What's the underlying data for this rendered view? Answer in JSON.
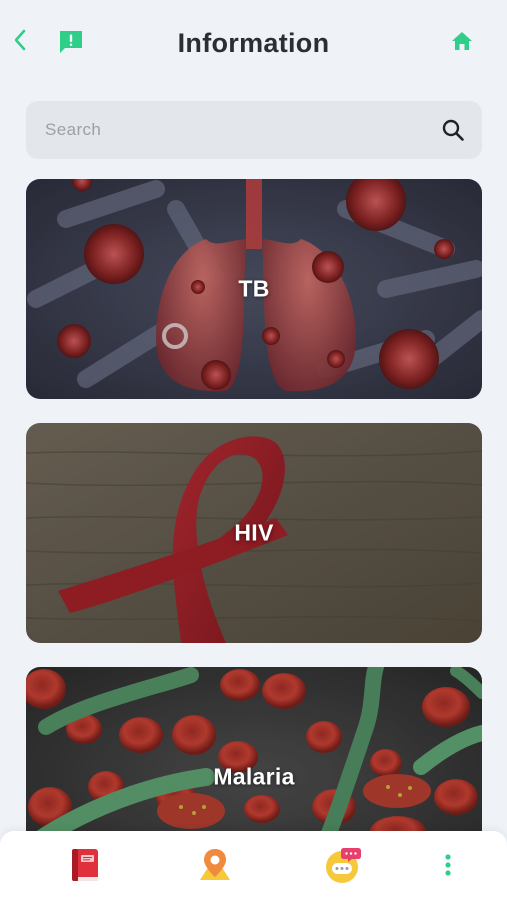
{
  "header": {
    "title": "Information",
    "back_icon": "chevron-left-icon",
    "feedback_icon": "feedback-icon",
    "home_icon": "home-icon",
    "accent_color": "#2fcf8a"
  },
  "search": {
    "placeholder": "Search",
    "value": "",
    "icon": "search-icon"
  },
  "cards": [
    {
      "id": "tb",
      "label": "TB"
    },
    {
      "id": "hiv",
      "label": "HIV"
    },
    {
      "id": "malaria",
      "label": "Malaria"
    }
  ],
  "bottom_nav": [
    {
      "name": "book-icon",
      "color": "#e0303c"
    },
    {
      "name": "map-pin-icon",
      "color": "#f08a3c"
    },
    {
      "name": "chat-bubble-icon",
      "color": "#f5c93a"
    },
    {
      "name": "more-vertical-icon",
      "color": "#2fcf8a"
    }
  ]
}
